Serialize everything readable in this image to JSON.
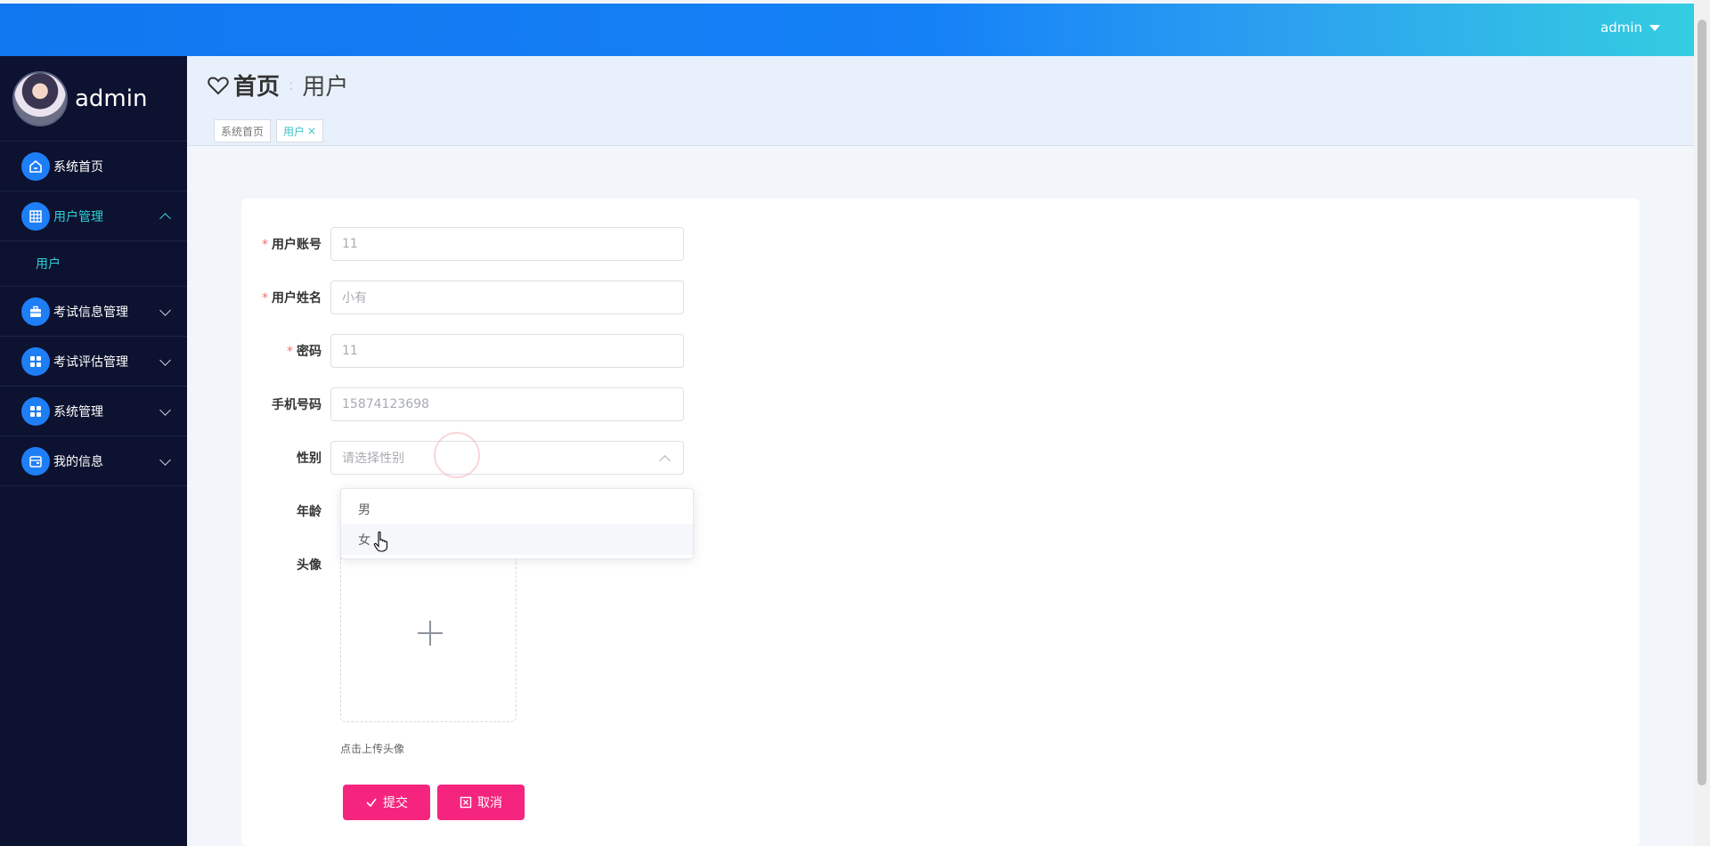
{
  "topbar": {
    "user": "admin"
  },
  "sidebar": {
    "profile_name": "admin",
    "items": [
      {
        "label": "系统首页",
        "icon": "home-icon"
      },
      {
        "label": "用户管理",
        "icon": "grid-icon",
        "expanded": true,
        "children": [
          {
            "label": "用户"
          }
        ]
      },
      {
        "label": "考试信息管理",
        "icon": "briefcase-icon"
      },
      {
        "label": "考试评估管理",
        "icon": "apps-icon"
      },
      {
        "label": "系统管理",
        "icon": "apps-icon"
      },
      {
        "label": "我的信息",
        "icon": "wallet-icon"
      }
    ]
  },
  "breadcrumb": {
    "home": "首页",
    "separator": ":",
    "current": "用户"
  },
  "tags": [
    {
      "label": "系统首页"
    },
    {
      "label": "用户",
      "close": "×"
    }
  ],
  "form": {
    "account": {
      "label": "用户账号",
      "value": "11",
      "required": "*"
    },
    "name": {
      "label": "用户姓名",
      "value": "小有",
      "required": "*"
    },
    "password": {
      "label": "密码",
      "value": "11",
      "required": "*"
    },
    "phone": {
      "label": "手机号码",
      "value": "15874123698"
    },
    "gender": {
      "label": "性别",
      "placeholder": "请选择性别",
      "options": [
        "男",
        "女"
      ],
      "hovered": "女"
    },
    "age": {
      "label": "年龄"
    },
    "avatar": {
      "label": "头像",
      "tip": "点击上传头像"
    },
    "submit_label": "提交",
    "cancel_label": "取消"
  },
  "colors": {
    "topbar_start": "#1177f0",
    "topbar_end": "#34cde1",
    "sidebar_bg": "#0d1230",
    "accent_teal": "#2fd1d6",
    "button_pink": "#f5257f",
    "icon_blue": "#1e7ef6"
  }
}
